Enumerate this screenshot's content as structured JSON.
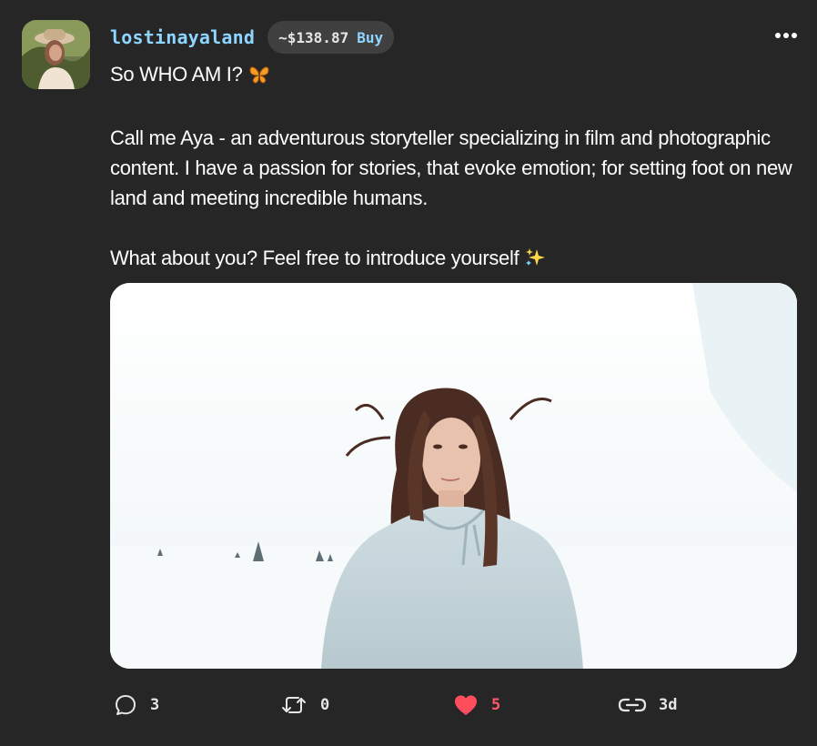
{
  "post": {
    "author": {
      "username": "lostinayaland",
      "avatar_alt": "avatar"
    },
    "price_pill": {
      "price": "~$138.87",
      "buy_label": "Buy"
    },
    "menu_icon": "more-horizontal-icon",
    "text": {
      "line1": "So WHO AM I?",
      "line1_emoji": "butterfly-emoji",
      "paragraph2": "Call me Aya - an adventurous storyteller specializing in film and photographic content. I have a passion for stories, that evoke emotion; for setting foot on new land and meeting incredible humans.",
      "paragraph3": "What about you? Feel free to introduce yourself",
      "paragraph3_emoji": "sparkles-emoji"
    },
    "media": {
      "description_icon": "photo-woman-in-snow"
    },
    "actions": {
      "replies": "3",
      "recasts": "0",
      "likes": "5",
      "time": "3d"
    },
    "colors": {
      "background": "#262626",
      "username": "#8ed6ff",
      "buy": "#8ed6ff",
      "like": "#ff5a6a",
      "pill": "#404040"
    }
  }
}
